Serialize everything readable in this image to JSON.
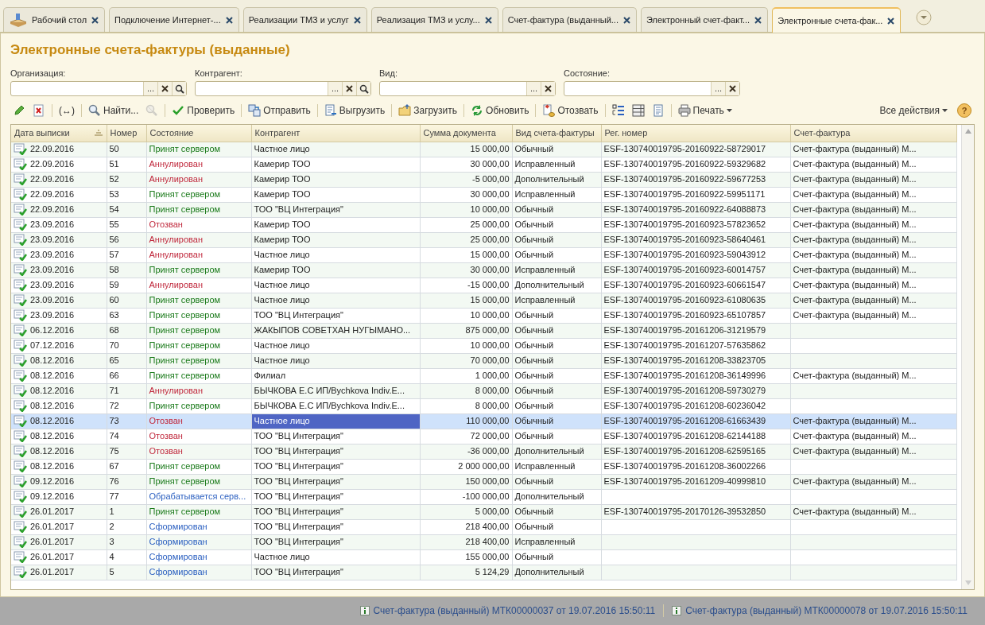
{
  "tabs": [
    {
      "label": "Рабочий стол",
      "selected": false
    },
    {
      "label": "Подключение Интернет-...",
      "selected": false
    },
    {
      "label": "Реализации ТМЗ и услуг",
      "selected": false
    },
    {
      "label": "Реализация ТМЗ и услу...",
      "selected": false
    },
    {
      "label": "Счет-фактура (выданный...",
      "selected": false
    },
    {
      "label": "Электронный счет-факт...",
      "selected": false
    },
    {
      "label": "Электронные счета-фак...",
      "selected": true
    }
  ],
  "title": "Электронные счета-фактуры (выданные)",
  "filters": [
    {
      "label": "Организация:",
      "buttons": [
        {
          "kind": "choose",
          "text": "..."
        },
        {
          "kind": "clear"
        },
        {
          "kind": "search"
        }
      ]
    },
    {
      "label": "Контрагент:",
      "buttons": [
        {
          "kind": "choose",
          "text": "..."
        },
        {
          "kind": "clear"
        },
        {
          "kind": "search"
        }
      ]
    },
    {
      "label": "Вид:",
      "buttons": [
        {
          "kind": "choose",
          "text": "..."
        },
        {
          "kind": "clear"
        }
      ]
    },
    {
      "label": "Состояние:",
      "buttons": [
        {
          "kind": "choose",
          "text": "..."
        },
        {
          "kind": "clear"
        }
      ]
    }
  ],
  "toolbar": [
    {
      "disabled": false
    },
    {
      "disabled": false
    },
    {
      "label": "(↔)",
      "disabled": false
    },
    {
      "label": "Найти...",
      "disabled": false
    },
    {
      "disabled": true
    },
    {
      "label": "Проверить",
      "disabled": false
    },
    {
      "label": "Отправить",
      "disabled": false
    },
    {
      "label": "Выгрузить",
      "disabled": false
    },
    {
      "label": "Загрузить",
      "disabled": false
    },
    {
      "label": "Обновить",
      "disabled": false
    },
    {
      "label": "Отозвать",
      "disabled": false
    },
    {
      "disabled": false
    },
    {
      "disabled": false
    },
    {
      "disabled": false
    },
    {
      "label": "Печать",
      "disabled": false
    }
  ],
  "all_actions": "Все действия",
  "help": "?",
  "table": {
    "columns": [
      {
        "label": "Дата выписки",
        "sorted": true
      },
      {
        "label": "Номер",
        "sorted": false
      },
      {
        "label": "Состояние",
        "sorted": false
      },
      {
        "label": "Контрагент",
        "sorted": false
      },
      {
        "label": "Сумма документа",
        "sorted": false
      },
      {
        "label": "Вид счета-фактуры",
        "sorted": false
      },
      {
        "label": "Рег. номер",
        "sorted": false
      },
      {
        "label": "Счет-фактура",
        "sorted": false
      }
    ],
    "rows": [
      {
        "selected": false,
        "color": "#1a7a1a",
        "cells": [
          "22.09.2016",
          "50",
          "Принят сервером",
          "Частное лицо",
          "15 000,00",
          "Обычный",
          "ESF-130740019795-20160922-58729017",
          "Счет-фактура (выданный) М..."
        ]
      },
      {
        "selected": false,
        "color": "#c0283c",
        "cells": [
          "22.09.2016",
          "51",
          "Аннулирован",
          "Камерир ТОО",
          "30 000,00",
          "Исправленный",
          "ESF-130740019795-20160922-59329682",
          "Счет-фактура (выданный) М..."
        ]
      },
      {
        "selected": false,
        "color": "#c0283c",
        "cells": [
          "22.09.2016",
          "52",
          "Аннулирован",
          "Камерир ТОО",
          "-5 000,00",
          "Дополнительный",
          "ESF-130740019795-20160922-59677253",
          "Счет-фактура (выданный) М..."
        ]
      },
      {
        "selected": false,
        "color": "#1a7a1a",
        "cells": [
          "22.09.2016",
          "53",
          "Принят сервером",
          "Камерир ТОО",
          "30 000,00",
          "Исправленный",
          "ESF-130740019795-20160922-59951171",
          "Счет-фактура (выданный) М..."
        ]
      },
      {
        "selected": false,
        "color": "#1a7a1a",
        "cells": [
          "22.09.2016",
          "54",
          "Принят сервером",
          "ТОО \"ВЦ Интеграция\"",
          "10 000,00",
          "Обычный",
          "ESF-130740019795-20160922-64088873",
          "Счет-фактура (выданный) М..."
        ]
      },
      {
        "selected": false,
        "color": "#c0283c",
        "cells": [
          "23.09.2016",
          "55",
          "Отозван",
          "Камерир ТОО",
          "25 000,00",
          "Обычный",
          "ESF-130740019795-20160923-57823652",
          "Счет-фактура (выданный) М..."
        ]
      },
      {
        "selected": false,
        "color": "#c0283c",
        "cells": [
          "23.09.2016",
          "56",
          "Аннулирован",
          "Камерир ТОО",
          "25 000,00",
          "Обычный",
          "ESF-130740019795-20160923-58640461",
          "Счет-фактура (выданный) М..."
        ]
      },
      {
        "selected": false,
        "color": "#c0283c",
        "cells": [
          "23.09.2016",
          "57",
          "Аннулирован",
          "Частное лицо",
          "15 000,00",
          "Обычный",
          "ESF-130740019795-20160923-59043912",
          "Счет-фактура (выданный) М..."
        ]
      },
      {
        "selected": false,
        "color": "#1a7a1a",
        "cells": [
          "23.09.2016",
          "58",
          "Принят сервером",
          "Камерир ТОО",
          "30 000,00",
          "Исправленный",
          "ESF-130740019795-20160923-60014757",
          "Счет-фактура (выданный) М..."
        ]
      },
      {
        "selected": false,
        "color": "#c0283c",
        "cells": [
          "23.09.2016",
          "59",
          "Аннулирован",
          "Частное лицо",
          "-15 000,00",
          "Дополнительный",
          "ESF-130740019795-20160923-60661547",
          "Счет-фактура (выданный) М..."
        ]
      },
      {
        "selected": false,
        "color": "#1a7a1a",
        "cells": [
          "23.09.2016",
          "60",
          "Принят сервером",
          "Частное лицо",
          "15 000,00",
          "Исправленный",
          "ESF-130740019795-20160923-61080635",
          "Счет-фактура (выданный) М..."
        ]
      },
      {
        "selected": false,
        "color": "#1a7a1a",
        "cells": [
          "23.09.2016",
          "63",
          "Принят сервером",
          "ТОО \"ВЦ Интеграция\"",
          "10 000,00",
          "Обычный",
          "ESF-130740019795-20160923-65107857",
          "Счет-фактура (выданный) М..."
        ]
      },
      {
        "selected": false,
        "color": "#1a7a1a",
        "cells": [
          "06.12.2016",
          "68",
          "Принят сервером",
          "ЖАКЫПОВ СОВЕТХАН НУГЫМАНО...",
          "875 000,00",
          "Обычный",
          "ESF-130740019795-20161206-31219579",
          ""
        ]
      },
      {
        "selected": false,
        "color": "#1a7a1a",
        "cells": [
          "07.12.2016",
          "70",
          "Принят сервером",
          "Частное лицо",
          "10 000,00",
          "Обычный",
          "ESF-130740019795-20161207-57635862",
          ""
        ]
      },
      {
        "selected": false,
        "color": "#1a7a1a",
        "cells": [
          "08.12.2016",
          "65",
          "Принят сервером",
          "Частное лицо",
          "70 000,00",
          "Обычный",
          "ESF-130740019795-20161208-33823705",
          ""
        ]
      },
      {
        "selected": false,
        "color": "#1a7a1a",
        "cells": [
          "08.12.2016",
          "66",
          "Принят сервером",
          "Филиал",
          "1 000,00",
          "Обычный",
          "ESF-130740019795-20161208-36149996",
          "Счет-фактура (выданный) М..."
        ]
      },
      {
        "selected": false,
        "color": "#c0283c",
        "cells": [
          "08.12.2016",
          "71",
          "Аннулирован",
          "БЫЧКОВА Е.С ИП/Bychkova Indiv.E...",
          "8 000,00",
          "Обычный",
          "ESF-130740019795-20161208-59730279",
          ""
        ]
      },
      {
        "selected": false,
        "color": "#1a7a1a",
        "cells": [
          "08.12.2016",
          "72",
          "Принят сервером",
          "БЫЧКОВА Е.С ИП/Bychkova Indiv.E...",
          "8 000,00",
          "Обычный",
          "ESF-130740019795-20161208-60236042",
          ""
        ]
      },
      {
        "selected": true,
        "color": "#c0283c",
        "cells": [
          "08.12.2016",
          "73",
          "Отозван",
          "Частное лицо",
          "110 000,00",
          "Обычный",
          "ESF-130740019795-20161208-61663439",
          "Счет-фактура (выданный) М..."
        ]
      },
      {
        "selected": false,
        "color": "#c0283c",
        "cells": [
          "08.12.2016",
          "74",
          "Отозван",
          "ТОО \"ВЦ Интеграция\"",
          "72 000,00",
          "Обычный",
          "ESF-130740019795-20161208-62144188",
          "Счет-фактура (выданный) М..."
        ]
      },
      {
        "selected": false,
        "color": "#c0283c",
        "cells": [
          "08.12.2016",
          "75",
          "Отозван",
          "ТОО \"ВЦ Интеграция\"",
          "-36 000,00",
          "Дополнительный",
          "ESF-130740019795-20161208-62595165",
          "Счет-фактура (выданный) М..."
        ]
      },
      {
        "selected": false,
        "color": "#1a7a1a",
        "cells": [
          "08.12.2016",
          "67",
          "Принят сервером",
          "ТОО \"ВЦ Интеграция\"",
          "2 000 000,00",
          "Исправленный",
          "ESF-130740019795-20161208-36002266",
          ""
        ]
      },
      {
        "selected": false,
        "color": "#1a7a1a",
        "cells": [
          "09.12.2016",
          "76",
          "Принят сервером",
          "ТОО \"ВЦ Интеграция\"",
          "150 000,00",
          "Обычный",
          "ESF-130740019795-20161209-40999810",
          "Счет-фактура (выданный) М..."
        ]
      },
      {
        "selected": false,
        "color": "#2a5fc0",
        "cells": [
          "09.12.2016",
          "77",
          "Обрабатывается серв...",
          "ТОО \"ВЦ Интеграция\"",
          "-100 000,00",
          "Дополнительный",
          "",
          ""
        ]
      },
      {
        "selected": false,
        "color": "#1a7a1a",
        "cells": [
          "26.01.2017",
          "1",
          "Принят сервером",
          "ТОО \"ВЦ Интеграция\"",
          "5 000,00",
          "Обычный",
          "ESF-130740019795-20170126-39532850",
          "Счет-фактура (выданный) М..."
        ]
      },
      {
        "selected": false,
        "color": "#2a5fc0",
        "cells": [
          "26.01.2017",
          "2",
          "Сформирован",
          "ТОО \"ВЦ Интеграция\"",
          "218 400,00",
          "Обычный",
          "",
          ""
        ]
      },
      {
        "selected": false,
        "color": "#2a5fc0",
        "cells": [
          "26.01.2017",
          "3",
          "Сформирован",
          "ТОО \"ВЦ Интеграция\"",
          "218 400,00",
          "Исправленный",
          "",
          ""
        ]
      },
      {
        "selected": false,
        "color": "#2a5fc0",
        "cells": [
          "26.01.2017",
          "4",
          "Сформирован",
          "Частное лицо",
          "155 000,00",
          "Обычный",
          "",
          ""
        ]
      },
      {
        "selected": false,
        "color": "#2a5fc0",
        "cells": [
          "26.01.2017",
          "5",
          "Сформирован",
          "ТОО \"ВЦ Интеграция\"",
          "5 124,29",
          "Дополнительный",
          "",
          ""
        ]
      }
    ]
  },
  "status_bar": [
    "Счет-фактура (выданный) МТК00000037 от 19.07.2016 15:50:11",
    "Счет-фактура (выданный) МТК00000078 от 19.07.2016 15:50:11"
  ]
}
